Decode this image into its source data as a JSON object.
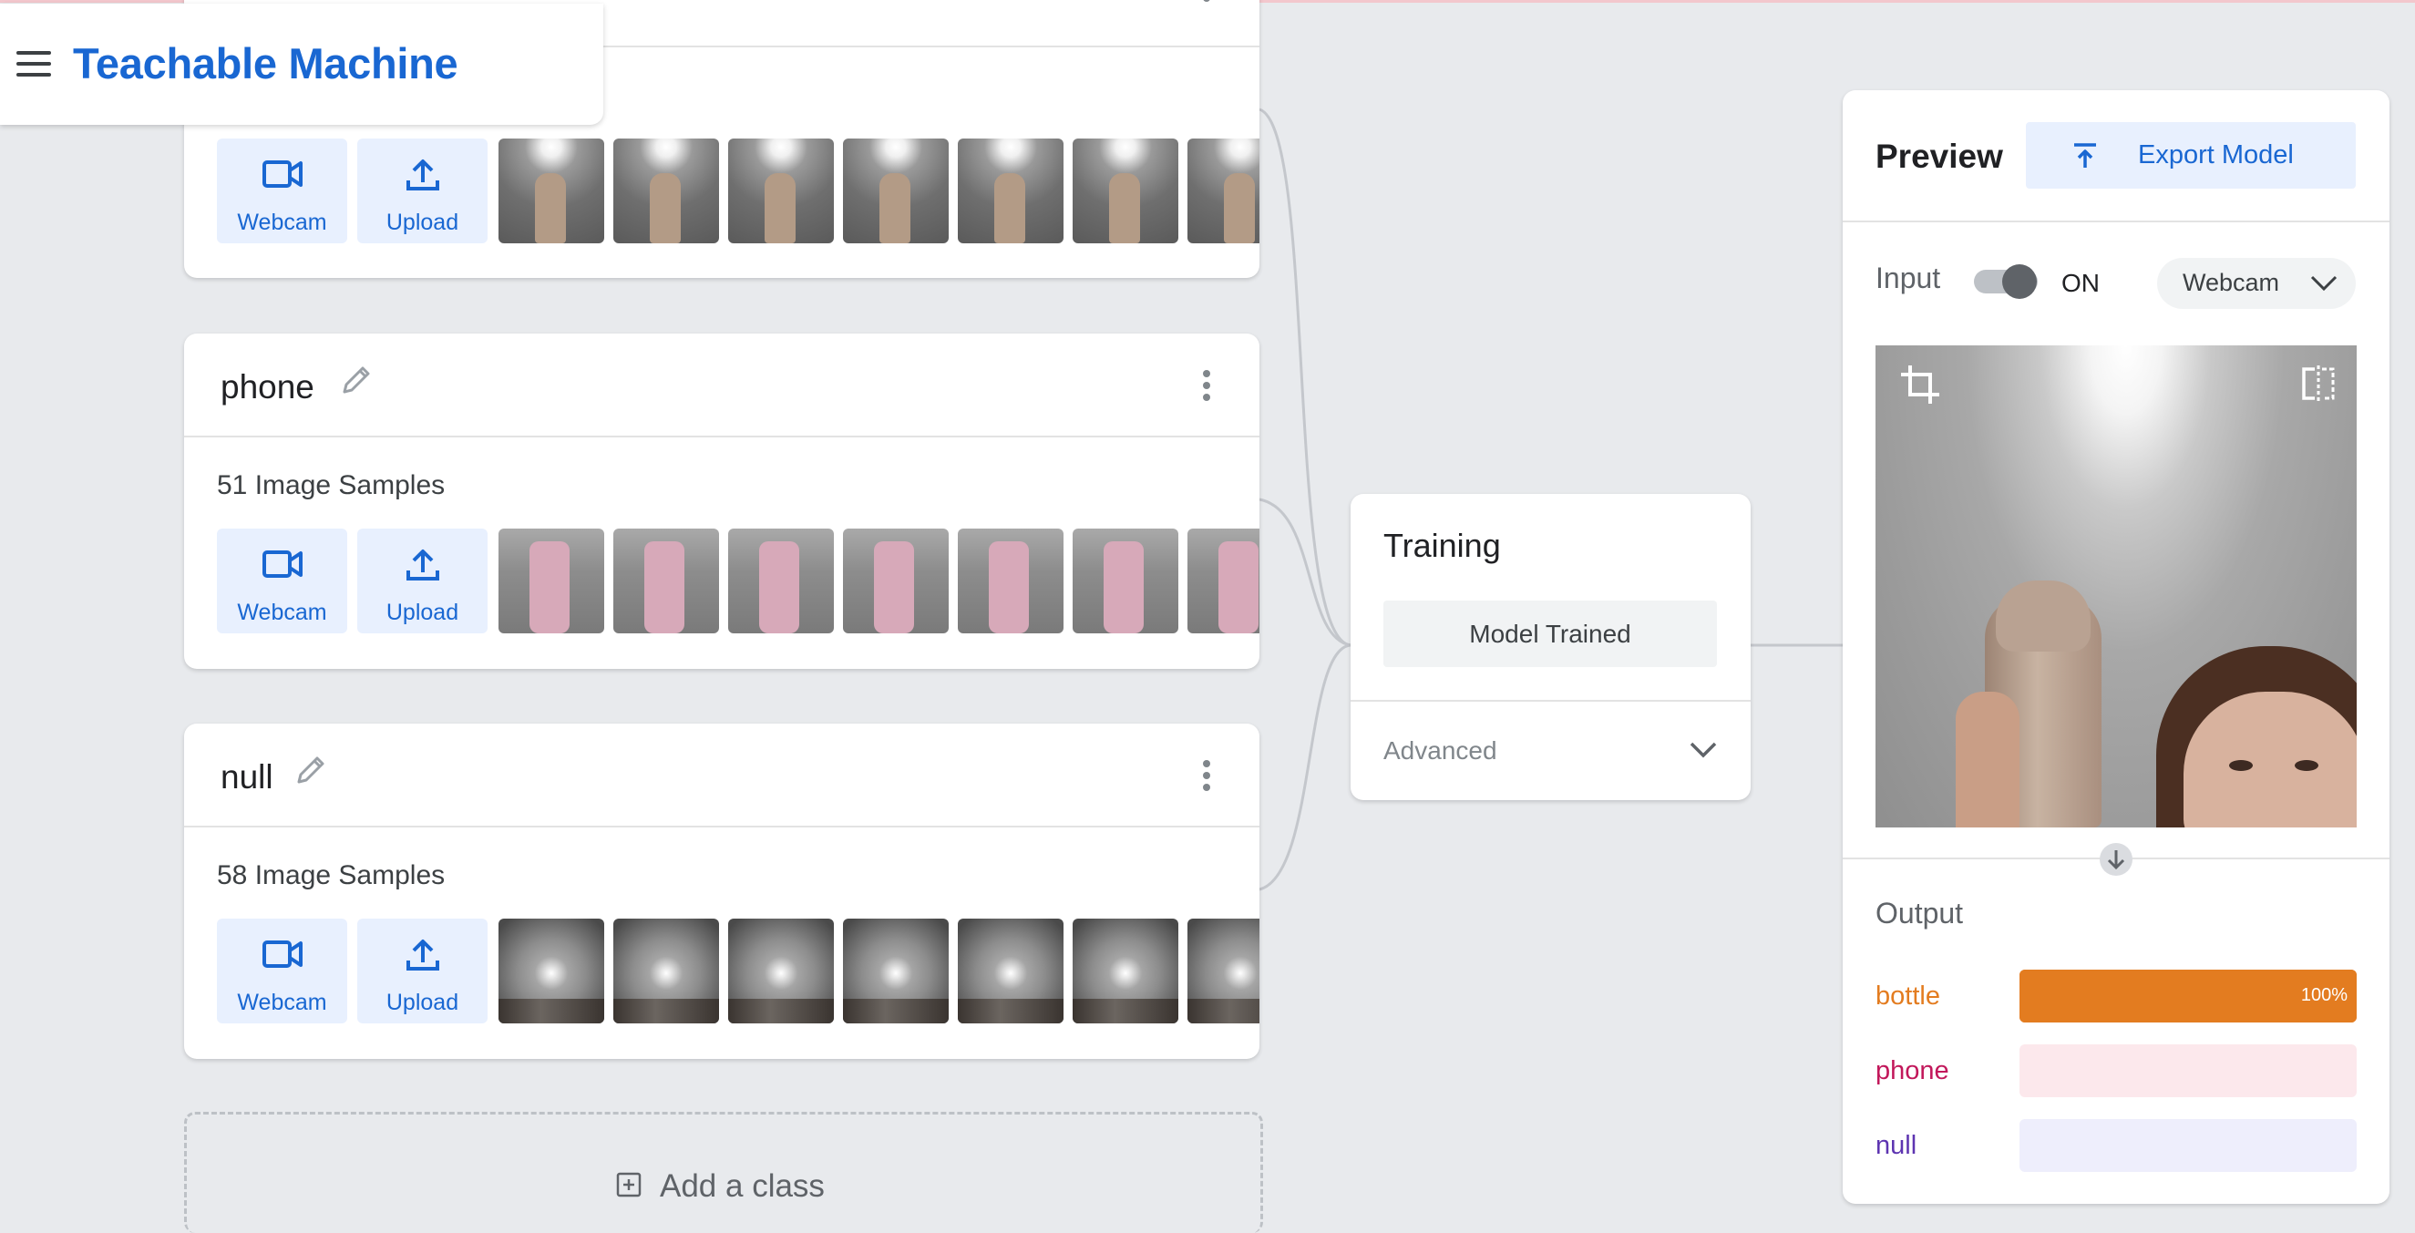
{
  "app": {
    "title": "Teachable Machine",
    "menu_icon": "hamburger-menu-icon"
  },
  "classes": [
    {
      "name": "",
      "sample_count_label": "",
      "webcam_label": "Webcam",
      "upload_label": "Upload",
      "thumbnail_subject": "bottle"
    },
    {
      "name": "phone",
      "sample_count_label": "51 Image Samples",
      "webcam_label": "Webcam",
      "upload_label": "Upload",
      "thumbnail_subject": "phone"
    },
    {
      "name": "null",
      "sample_count_label": "58 Image Samples",
      "webcam_label": "Webcam",
      "upload_label": "Upload",
      "thumbnail_subject": "null"
    }
  ],
  "add_class": {
    "label": "Add a class"
  },
  "training": {
    "title": "Training",
    "status_button": "Model Trained",
    "advanced_label": "Advanced"
  },
  "preview": {
    "title": "Preview",
    "export_label": "Export Model",
    "input_label": "Input",
    "toggle_state": "ON",
    "source_label": "Webcam",
    "output_label": "Output",
    "outputs": [
      {
        "label": "bottle",
        "percent": 100,
        "percent_text": "100%",
        "color": "#e37c20",
        "track": "#e37c20"
      },
      {
        "label": "phone",
        "percent": 0,
        "percent_text": "",
        "color": "#c2185b",
        "track": "#fce8ec"
      },
      {
        "label": "null",
        "percent": 0,
        "percent_text": "",
        "color": "#5e35b1",
        "track": "#eeeefc"
      }
    ]
  },
  "colors": {
    "brand": "#1967d2",
    "button_bg": "#e8f0fe",
    "page_bg": "#e8eaed"
  }
}
